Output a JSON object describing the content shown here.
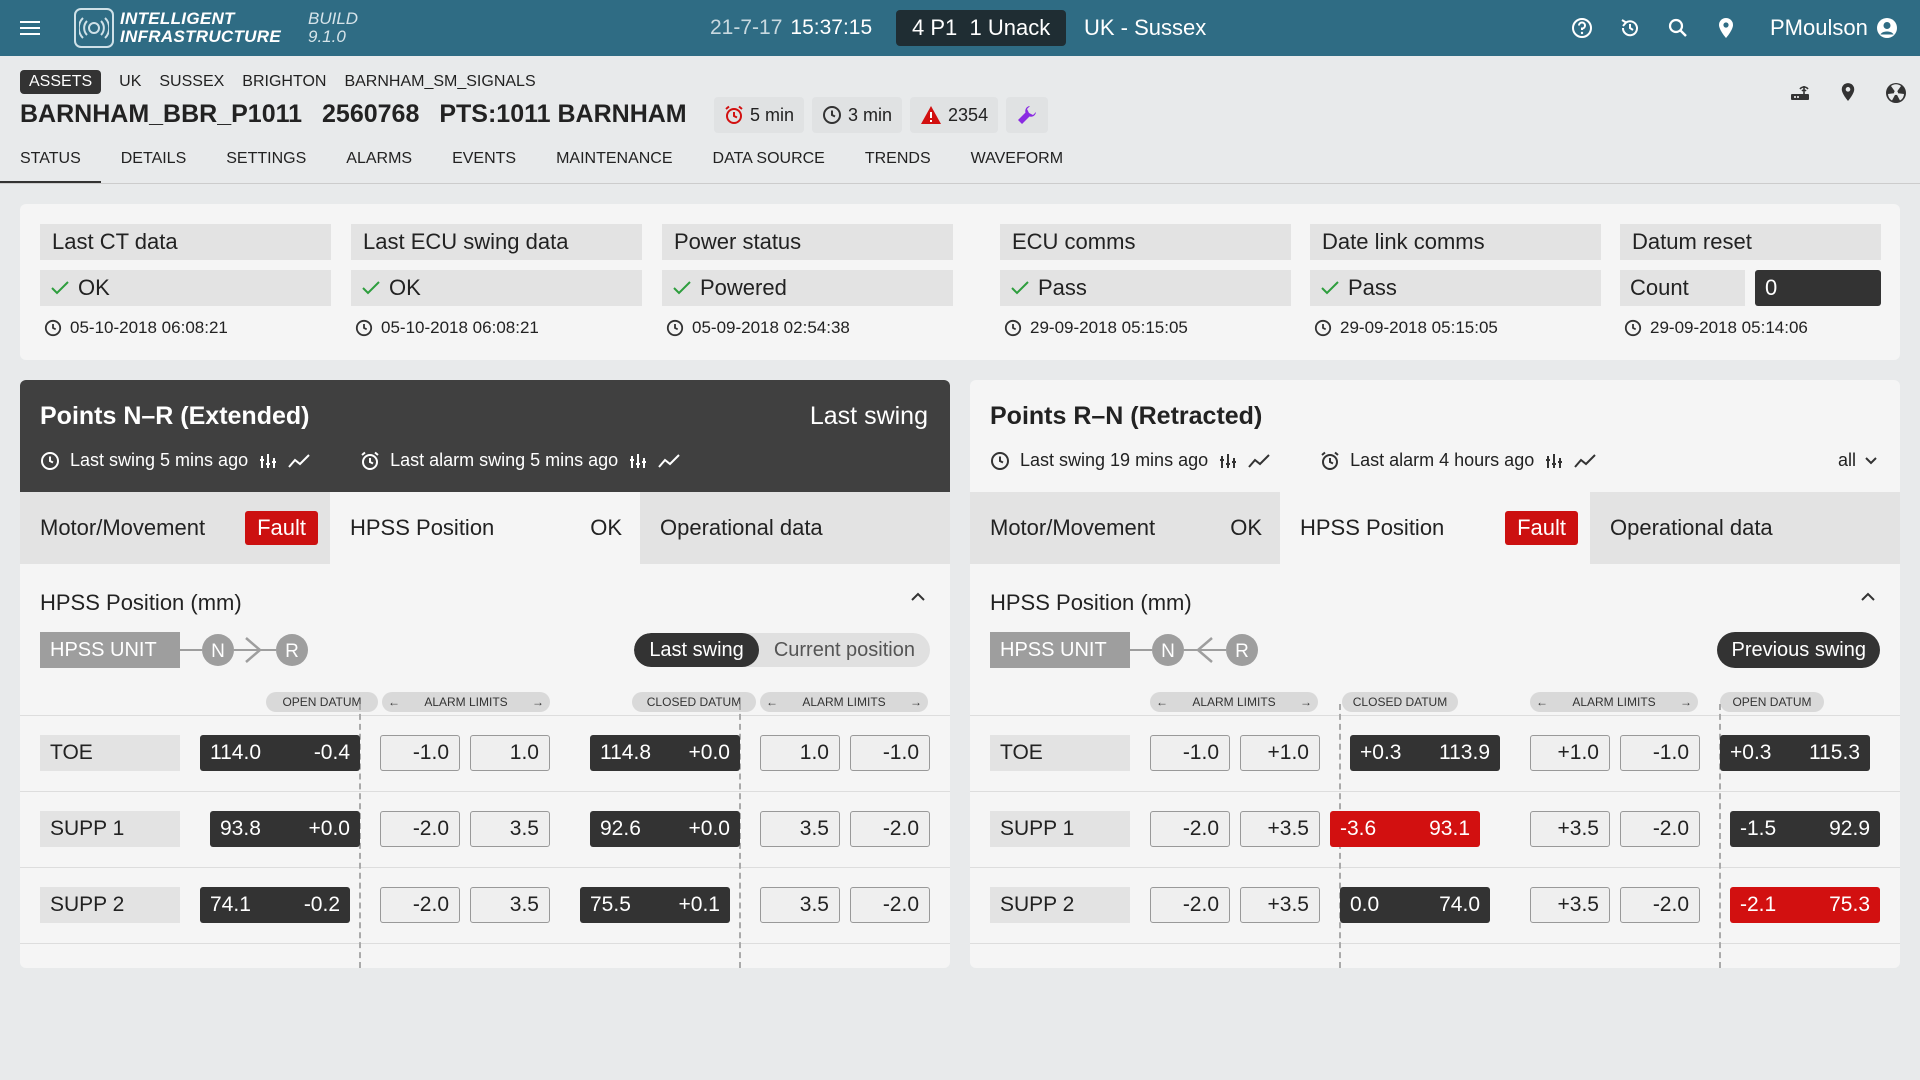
{
  "topbar": {
    "logo_line1": "INTELLIGENT",
    "logo_line2": "INFRASTRUCTURE",
    "build_line1": "BUILD",
    "build_line2": "9.1.0",
    "date": "21-7-17",
    "time": "15:37:15",
    "alarms": "4 P1  1 Unack",
    "region": "UK - Sussex",
    "user": "PMoulson"
  },
  "breadcrumb": {
    "tag": "ASSETS",
    "items": [
      "UK",
      "SUSSEX",
      "BRIGHTON",
      "BARNHAM_SM_SIGNALS"
    ]
  },
  "asset": {
    "name": "BARNHAM_BBR_P1011",
    "id": "2560768",
    "pts": "PTS:1011 BARNHAM"
  },
  "chips": {
    "alarm_time": "5 min",
    "clock_time": "3 min",
    "warning_count": "2354"
  },
  "tabs": [
    "STATUS",
    "DETAILS",
    "SETTINGS",
    "ALARMS",
    "EVENTS",
    "MAINTENANCE",
    "DATA SOURCE",
    "TRENDS",
    "WAVEFORM"
  ],
  "status": [
    {
      "label": "Last CT data",
      "value": "OK",
      "time": "05-10-2018 06:08:21"
    },
    {
      "label": "Last ECU swing data",
      "value": "OK",
      "time": "05-10-2018 06:08:21"
    },
    {
      "label": "Power status",
      "value": "Powered",
      "time": "05-09-2018 02:54:38"
    },
    {
      "label": "ECU comms",
      "value": "Pass",
      "time": "29-09-2018 05:15:05"
    },
    {
      "label": "Date link comms",
      "value": "Pass",
      "time": "29-09-2018 05:15:05"
    }
  ],
  "datum_reset": {
    "label": "Datum reset",
    "count_label": "Count",
    "count": "0",
    "time": "29-09-2018 05:14:06"
  },
  "left": {
    "title": "Points N–R (Extended)",
    "last_swing_title": "Last swing",
    "last_swing": "Last swing 5 mins ago",
    "last_alarm": "Last alarm swing 5 mins ago",
    "tabs": {
      "motor": "Motor/Movement",
      "motor_status": "Fault",
      "hpss": "HPSS Position",
      "hpss_status": "OK",
      "oper": "Operational data"
    },
    "section": "HPSS Position (mm)",
    "unit": "HPSS UNIT",
    "n": "N",
    "r": "R",
    "seg_last": "Last swing",
    "seg_current": "Current position",
    "headers": {
      "open": "OPEN DATUM",
      "alarm1": "ALARM LIMITS",
      "closed": "CLOSED DATUM",
      "alarm2": "ALARM LIMITS"
    },
    "rows": [
      {
        "label": "TOE",
        "open_a": "114.0",
        "open_b": "-0.4",
        "lim1_a": "-1.0",
        "lim1_b": "1.0",
        "closed_a": "114.8",
        "closed_b": "+0.0",
        "lim2_a": "1.0",
        "lim2_b": "-1.0"
      },
      {
        "label": "SUPP 1",
        "open_a": "93.8",
        "open_b": "+0.0",
        "lim1_a": "-2.0",
        "lim1_b": "3.5",
        "closed_a": "92.6",
        "closed_b": "+0.0",
        "lim2_a": "3.5",
        "lim2_b": "-2.0"
      },
      {
        "label": "SUPP 2",
        "open_a": "74.1",
        "open_b": "-0.2",
        "lim1_a": "-2.0",
        "lim1_b": "3.5",
        "closed_a": "75.5",
        "closed_b": "+0.1",
        "lim2_a": "3.5",
        "lim2_b": "-2.0"
      }
    ]
  },
  "right": {
    "title": "Points R–N (Retracted)",
    "last_swing": "Last swing 19 mins ago",
    "last_alarm": "Last alarm 4 hours ago",
    "filter": "all",
    "tabs": {
      "motor": "Motor/Movement",
      "motor_status": "OK",
      "hpss": "HPSS Position",
      "hpss_status": "Fault",
      "oper": "Operational data"
    },
    "section": "HPSS Position (mm)",
    "unit": "HPSS UNIT",
    "n": "N",
    "r": "R",
    "prev": "Previous swing",
    "headers": {
      "alarm1": "ALARM LIMITS",
      "closed": "CLOSED DATUM",
      "alarm2": "ALARM LIMITS",
      "open": "OPEN DATUM"
    },
    "rows": [
      {
        "label": "TOE",
        "lim1_a": "-1.0",
        "lim1_b": "+1.0",
        "closed_a": "+0.3",
        "closed_b": "113.9",
        "lim2_a": "+1.0",
        "lim2_b": "-1.0",
        "open_a": "+0.3",
        "open_b": "115.3"
      },
      {
        "label": "SUPP 1",
        "lim1_a": "-2.0",
        "lim1_b": "+3.5",
        "closed_a": "-3.6",
        "closed_b": "93.1",
        "lim2_a": "+3.5",
        "lim2_b": "-2.0",
        "open_a": "-1.5",
        "open_b": "92.9"
      },
      {
        "label": "SUPP 2",
        "lim1_a": "-2.0",
        "lim1_b": "+3.5",
        "closed_a": "0.0",
        "closed_b": "74.0",
        "lim2_a": "+3.5",
        "lim2_b": "-2.0",
        "open_a": "-2.1",
        "open_b": "75.3"
      }
    ]
  },
  "colors": {
    "topbar": "#2f6c84",
    "fault": "#cc1010",
    "dark": "#333333",
    "panel_dark": "#404040"
  }
}
